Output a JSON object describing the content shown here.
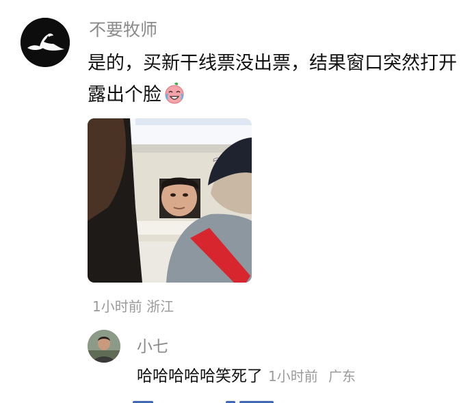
{
  "comment": {
    "username": "不要牧师",
    "text": "是的，买新干线票没出票，结果窗口突然打开露出个脸",
    "emoji_icon": "crying-laughing-emoji-icon",
    "meta": "1小时前 浙江",
    "photo_icon": "photo-ticket-window-face",
    "photo_question_mark": "?"
  },
  "reply": {
    "username": "小七",
    "text": "哈哈哈哈哈笑死了",
    "time": "1小时前",
    "location": "广东"
  },
  "colors": {
    "username": "#8a8a8a",
    "text": "#111111",
    "meta": "#9a9a9a",
    "link": "#3f68b5"
  }
}
